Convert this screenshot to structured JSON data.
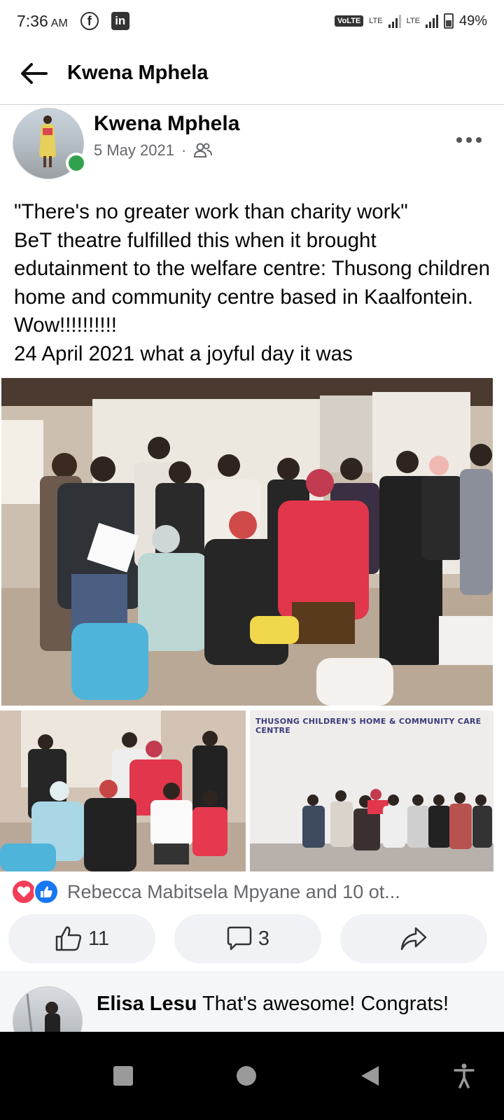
{
  "status_bar": {
    "time": "7:36",
    "ampm": "AM",
    "volte": "VoLTE",
    "lte1": "LTE",
    "lte2": "LTE",
    "battery": "49%",
    "apps": [
      "facebook-icon",
      "linkedin-icon"
    ]
  },
  "header": {
    "title": "Kwena Mphela",
    "back_icon": "arrow-left-icon"
  },
  "post": {
    "author": "Kwena Mphela",
    "date": "5 May 2021",
    "separator": "·",
    "audience_icon": "friends-icon",
    "online": true,
    "more_icon": "more-horizontal-icon",
    "text": "\"There's no greater work than charity work\"\nBeT theatre fulfilled this when it brought edutainment to the welfare centre: Thusong children home and community centre based in Kaalfontein. Wow!!!!!!!!!!\n24 April 2021 what a joyful day it was",
    "photos": {
      "banner_text": "THUSONG CHILDREN'S HOME & COMMUNITY CARE CENTRE"
    },
    "reactions": {
      "icons": [
        "heart-reaction-icon",
        "like-reaction-icon"
      ],
      "summary": "Rebecca Mabitsela Mpyane and 10 ot..."
    },
    "actions": {
      "like_count": "11",
      "comment_count": "3",
      "share_icon": "share-icon"
    }
  },
  "comment": {
    "name": "Elisa Lesu",
    "text": "That's awesome! Congrats!"
  },
  "colors": {
    "online": "#31a24c",
    "like_blue": "#1877f2",
    "heart_red": "#f33e58",
    "pill_bg": "#f0f2f5",
    "meta_gray": "#65676b"
  }
}
